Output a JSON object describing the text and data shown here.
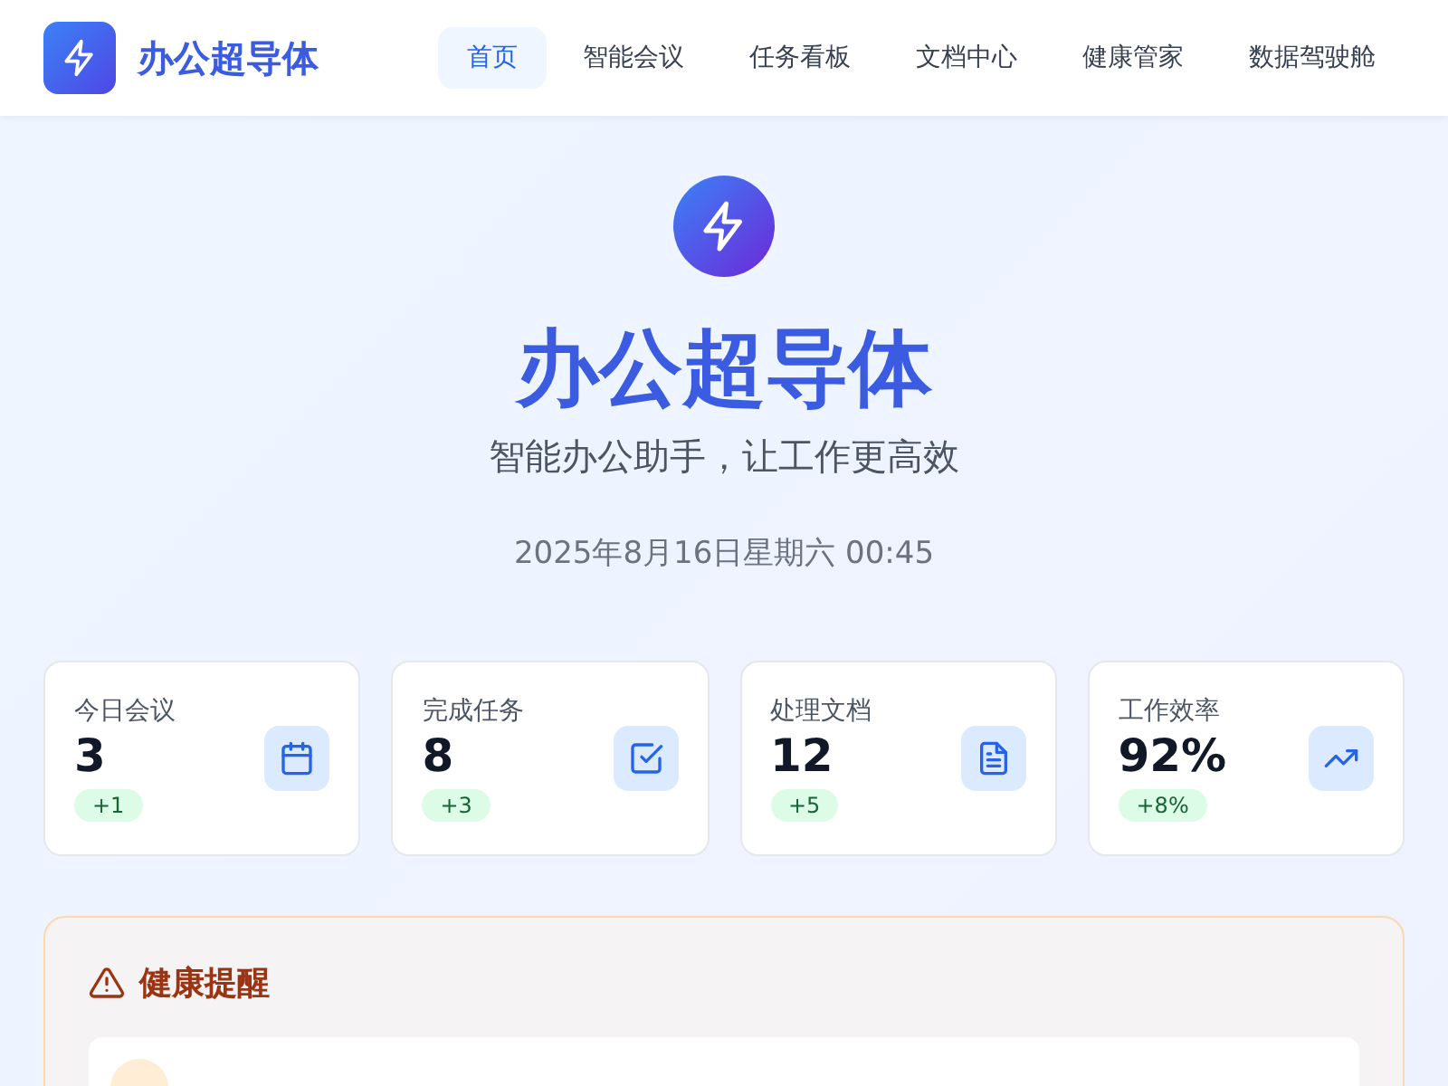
{
  "brand": {
    "name": "办公超导体"
  },
  "nav": [
    {
      "label": "首页",
      "selected": true
    },
    {
      "label": "智能会议",
      "selected": false
    },
    {
      "label": "任务看板",
      "selected": false
    },
    {
      "label": "文档中心",
      "selected": false
    },
    {
      "label": "健康管家",
      "selected": false
    },
    {
      "label": "数据驾驶舱",
      "selected": false
    }
  ],
  "hero": {
    "title": "办公超导体",
    "subtitle": "智能办公助手，让工作更高效",
    "datetime": "2025年8月16日星期六 00:45"
  },
  "stats": [
    {
      "label": "今日会议",
      "value": "3",
      "delta": "+1",
      "kind": "calendar"
    },
    {
      "label": "完成任务",
      "value": "8",
      "delta": "+3",
      "kind": "check"
    },
    {
      "label": "处理文档",
      "value": "12",
      "delta": "+5",
      "kind": "document"
    },
    {
      "label": "工作效率",
      "value": "92%",
      "delta": "+8%",
      "kind": "trend"
    }
  ],
  "health": {
    "title": "健康提醒"
  }
}
